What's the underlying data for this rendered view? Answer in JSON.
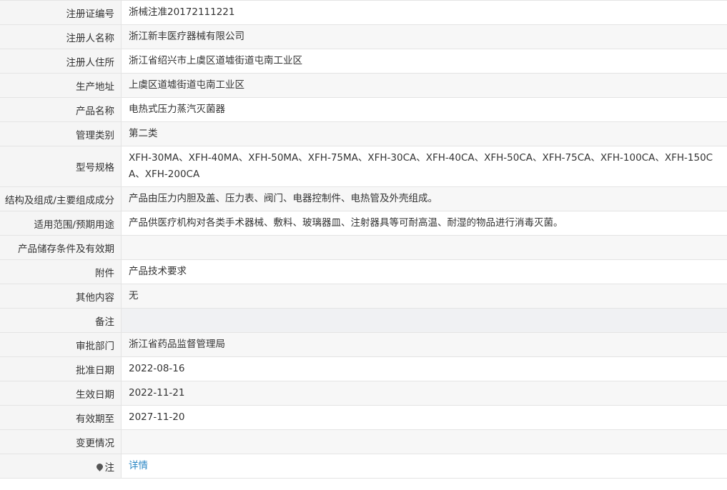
{
  "rows": [
    {
      "label": "注册证编号",
      "value": "浙械注准20172111221"
    },
    {
      "label": "注册人名称",
      "value": "浙江新丰医疗器械有限公司"
    },
    {
      "label": "注册人住所",
      "value": "浙江省绍兴市上虞区道墟街道屯南工业区"
    },
    {
      "label": "生产地址",
      "value": "上虞区道墟街道屯南工业区"
    },
    {
      "label": "产品名称",
      "value": "电热式压力蒸汽灭菌器"
    },
    {
      "label": "管理类别",
      "value": "第二类"
    },
    {
      "label": "型号规格",
      "value": "XFH-30MA、XFH-40MA、XFH-50MA、XFH-75MA、XFH-30CA、XFH-40CA、XFH-50CA、XFH-75CA、XFH-100CA、XFH-150CA、XFH-200CA"
    },
    {
      "label": "结构及组成/主要组成成分",
      "value": "产品由压力内胆及盖、压力表、阀门、电器控制件、电热管及外壳组成。"
    },
    {
      "label": "适用范围/预期用途",
      "value": "产品供医疗机构对各类手术器械、敷料、玻璃器皿、注射器具等可耐高温、耐湿的物品进行消毒灭菌。"
    },
    {
      "label": "产品储存条件及有效期",
      "value": ""
    },
    {
      "label": "附件",
      "value": "产品技术要求"
    },
    {
      "label": "其他内容",
      "value": "无"
    },
    {
      "label": "备注",
      "value": ""
    },
    {
      "label": "审批部门",
      "value": "浙江省药品监督管理局"
    },
    {
      "label": "批准日期",
      "value": "2022-08-16"
    },
    {
      "label": "生效日期",
      "value": "2022-11-21"
    },
    {
      "label": "有效期至",
      "value": "2027-11-20"
    },
    {
      "label": "变更情况",
      "value": ""
    }
  ],
  "note_row": {
    "icon": "pin-icon",
    "label": "注",
    "link": "详情"
  },
  "colors": {
    "label_bg": "#f5f5f5",
    "border": "#e4e4e4",
    "link": "#2a86c4",
    "text": "#333333"
  }
}
